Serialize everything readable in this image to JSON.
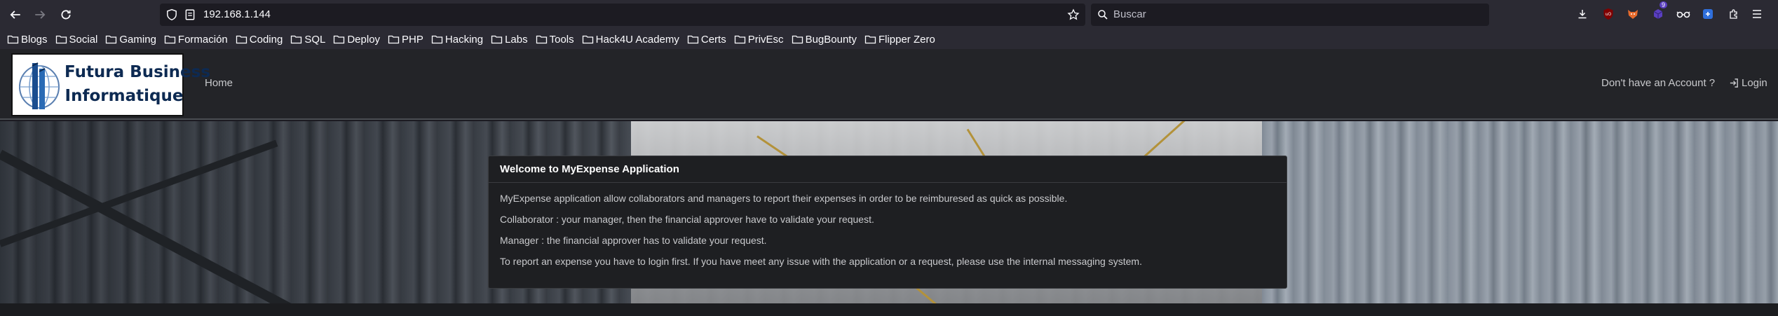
{
  "browser": {
    "url": "192.168.1.144",
    "search_placeholder": "Buscar",
    "extension_badge": "9"
  },
  "bookmarks": [
    "Blogs",
    "Social",
    "Gaming",
    "Formación",
    "Coding",
    "SQL",
    "Deploy",
    "PHP",
    "Hacking",
    "Labs",
    "Tools",
    "Hack4U Academy",
    "Certs",
    "PrivEsc",
    "BugBounty",
    "Flipper Zero"
  ],
  "site": {
    "logo_line1": "Futura Business",
    "logo_line2": "Informatique",
    "nav_home": "Home",
    "nav_register": "Don't have an Account ?",
    "nav_login": "Login"
  },
  "welcome": {
    "title": "Welcome to MyExpense Application",
    "paragraphs": [
      "MyExpense application allow collaborators and managers to report their expenses in order to be reimburesed as quick as possible.",
      "Collaborator : your manager, then the financial approver have to validate your request.",
      "Manager : the financial approver has to validate your request.",
      "To report an expense you have to login first. If you have meet any issue with the application or a request, please use the internal messaging system."
    ]
  },
  "colors": {
    "toolbar": "#2b2a33",
    "header": "#232428",
    "card": "#1e1f22",
    "logo_text": "#0d2a52"
  }
}
